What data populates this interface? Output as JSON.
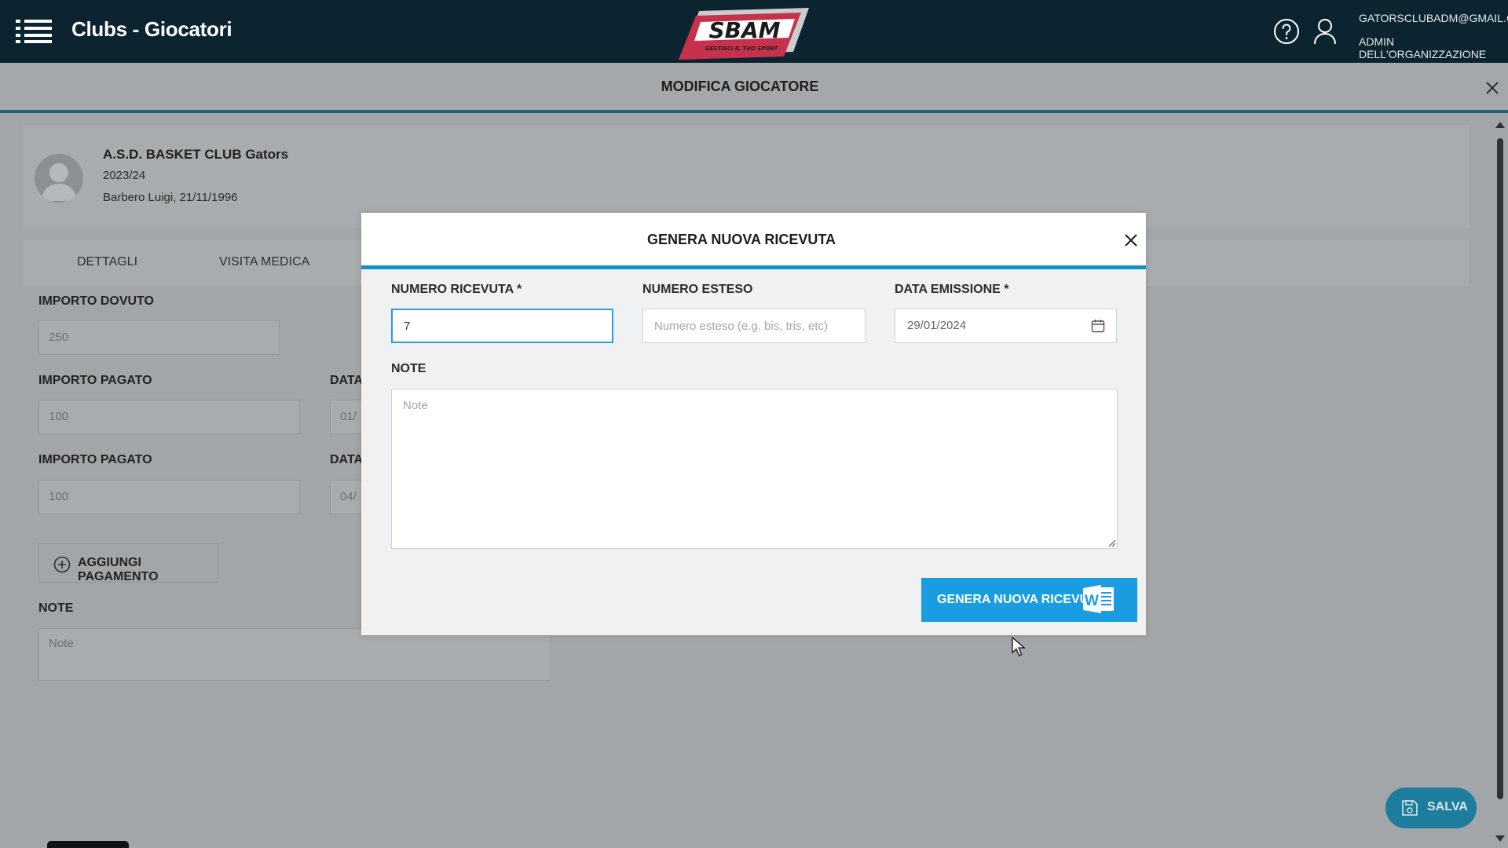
{
  "header": {
    "app_title": "Clubs - Giocatori",
    "logo_text": "SBAM",
    "logo_tagline": "GESTISCI IL TUO SPORT",
    "user_email": "GATORSCLUBADM@GMAIL.COM",
    "user_role": "ADMIN DELL'ORGANIZZAZIONE"
  },
  "page": {
    "title": "MODIFICA GIOCATORE"
  },
  "player_card": {
    "club_name": "A.S.D. BASKET CLUB Gators",
    "season": "2023/24",
    "player": "Barbero Luigi, 21/11/1996"
  },
  "tabs": [
    {
      "label": "DETTAGLI"
    },
    {
      "label": "VISITA MEDICA"
    }
  ],
  "form": {
    "importo_dovuto_label": "IMPORTO DOVUTO",
    "importo_dovuto_value": "250",
    "payments": [
      {
        "importo_label": "IMPORTO PAGATO",
        "importo_value": "100",
        "data_label": "DATA",
        "data_value": "01/"
      },
      {
        "importo_label": "IMPORTO PAGATO",
        "importo_value": "100",
        "data_label": "DATA",
        "data_value": "04/"
      }
    ],
    "add_payment_label": "AGGIUNGI PAGAMENTO",
    "note_label": "NOTE",
    "note_placeholder": "Note"
  },
  "save_button": {
    "label": "SALVA"
  },
  "modal": {
    "title": "GENERA NUOVA RICEVUTA",
    "numero_ricevuta_label": "NUMERO RICEVUTA *",
    "numero_ricevuta_value": "7",
    "numero_esteso_label": "NUMERO ESTESO",
    "numero_esteso_placeholder": "Numero esteso (e.g. bis, tris, etc)",
    "data_emissione_label": "DATA EMISSIONE *",
    "data_emissione_value": "29/01/2024",
    "note_label": "NOTE",
    "note_placeholder": "Note",
    "generate_button_label": "GENERA NUOVA RICEVUTA",
    "word_icon_letter": "W"
  },
  "colors": {
    "topbar": "#0c2430",
    "accent_blue": "#1a9de0",
    "header_underline": "#17627c",
    "save_button": "#1d7d9d"
  }
}
